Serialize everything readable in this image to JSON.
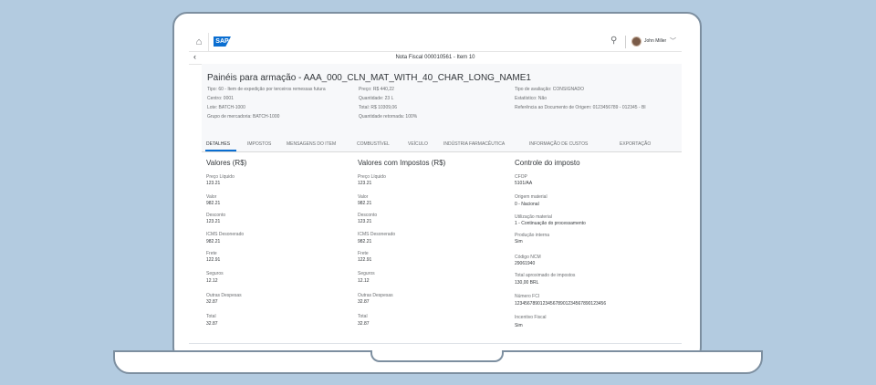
{
  "shell": {
    "logo": "SAP",
    "user_name": "John Miller"
  },
  "subheader": {
    "title": "Nota Fiscal 000010561 - Item 10"
  },
  "object_header": {
    "title": "Painéis para armação - AAA_000_CLN_MAT_WITH_40_CHAR_LONG_NAME1",
    "attributes_col1": [
      "Tipo: 60 - Item de expedição por terceiros remessas futura",
      "Centro: 0001",
      "Lote: BATCH-1000",
      "Grupo de mercadoria: BATCH-1000"
    ],
    "attributes_col2": [
      "Preço: R$ 440,22",
      "Quantidade: 23 L",
      "Total: R$ 10309,06",
      "Quantidade retornada: 100%"
    ],
    "attributes_col3": [
      "Tipo de avaliação: CONSIGNADO",
      "Estatístico: Não",
      "Referência ao Documento de Origem: 0123456789 - 012345 - BI"
    ]
  },
  "tabs": [
    "DETALHES",
    "IMPOSTOS",
    "MENSAGENS DO ITEM",
    "COMBUSTÍVEL",
    "VEÍCULO",
    "INDÚSTRIA FARMACÊUTICA",
    "INFORMAÇÃO DE CUSTOS",
    "EXPORTAÇÃO"
  ],
  "valores": {
    "heading": "Valores (R$)",
    "fields": [
      {
        "label": "Preço Líquido",
        "value": "123.21"
      },
      {
        "label": "Valor",
        "value": "982.21"
      },
      {
        "label": "Desconto",
        "value": "123.21"
      },
      {
        "label": "ICMS Desonerado",
        "value": "982.21"
      },
      {
        "label": "Frete",
        "value": "122.91"
      },
      {
        "label": "Seguros",
        "value": "12.12"
      },
      {
        "label": "Outras Despesas",
        "value": "32.87"
      },
      {
        "label": "Total",
        "value": "32.87"
      }
    ]
  },
  "valores_impostos": {
    "heading": "Valores com Impostos (R$)",
    "fields": [
      {
        "label": "Preço Líquido",
        "value": "123.21"
      },
      {
        "label": "Valor",
        "value": "982.21"
      },
      {
        "label": "Desconto",
        "value": "123.21"
      },
      {
        "label": "ICMS Desonerado",
        "value": "982.21"
      },
      {
        "label": "Frete",
        "value": "122.91"
      },
      {
        "label": "Seguros",
        "value": "12.12"
      },
      {
        "label": "Outras Despesas",
        "value": "32.87"
      },
      {
        "label": "Total",
        "value": "32.87"
      }
    ]
  },
  "controle": {
    "heading": "Controle do imposto",
    "fields": [
      {
        "label": "CFOP",
        "value": "5101/AA"
      },
      {
        "label": "Origem material",
        "value": "0 - Nacional"
      },
      {
        "label": "Utilização material",
        "value": "1 - Continuação do processamento"
      },
      {
        "label": "Produção interna",
        "value": "Sim"
      },
      {
        "label": "Código NCM",
        "value": "29061940"
      },
      {
        "label": "Total aproximado de impostos",
        "value": "130,00 BRL"
      },
      {
        "label": "Número FCI",
        "value": "123456789012345678901234567890123456"
      },
      {
        "label": "Incentivo Fiscal",
        "value": "Sim"
      }
    ]
  }
}
